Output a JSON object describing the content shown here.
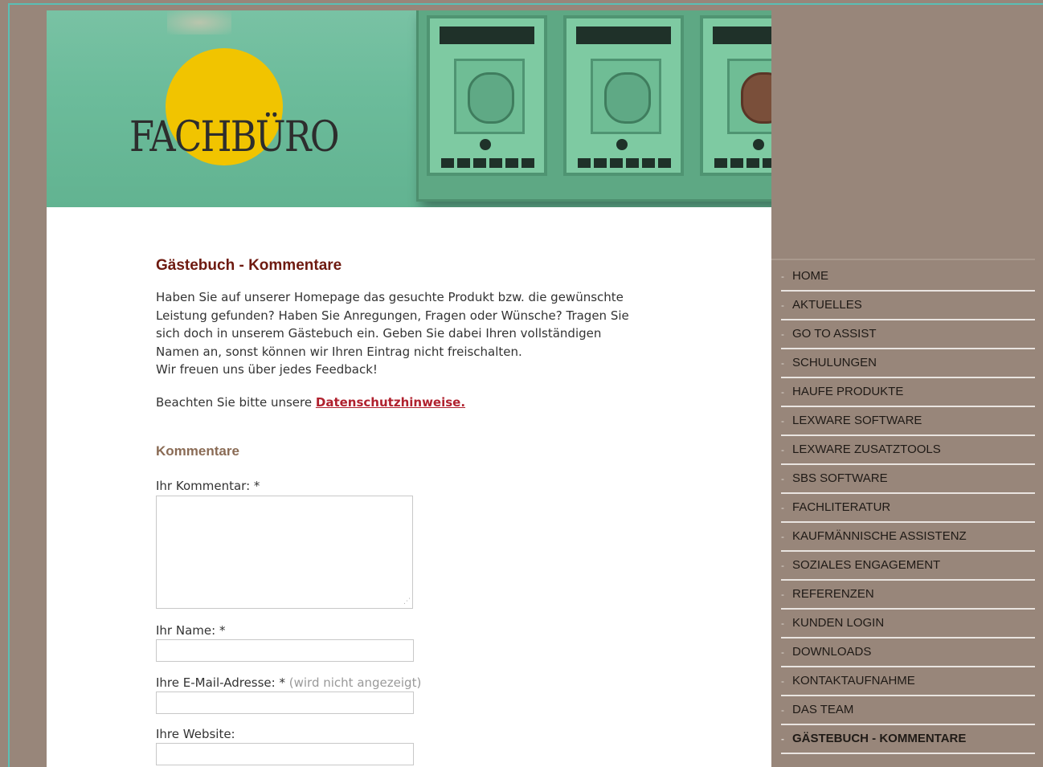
{
  "header": {
    "logo_text": "FACHBÜRO"
  },
  "main": {
    "title": "Gästebuch - Kommentare",
    "intro_lines": [
      "Haben Sie auf unserer Homepage das gesuchte Produkt bzw. die gewünschte",
      "Leistung gefunden? Haben Sie Anregungen, Fragen oder Wünsche? Tragen Sie",
      "sich doch in unserem Gästebuch ein. Geben Sie dabei Ihren vollständigen",
      "Namen an, sonst können wir Ihren Eintrag nicht freischalten.",
      "Wir freuen uns über jedes Feedback!"
    ],
    "privacy_prefix": "Beachten Sie bitte unsere",
    "privacy_link": "Datenschutzhinweise."
  },
  "comments": {
    "heading": "Kommentare",
    "comment_label": "Ihr Kommentar: *",
    "comment_value": "",
    "name_label": "Ihr Name: *",
    "name_value": "",
    "email_label": "Ihre E-Mail-Adresse: *",
    "email_hint": "(wird nicht angezeigt)",
    "email_value": "",
    "website_label": "Ihre Website:",
    "website_value": ""
  },
  "sidebar": {
    "items": [
      {
        "label": "HOME"
      },
      {
        "label": "AKTUELLES"
      },
      {
        "label": "GO TO ASSIST"
      },
      {
        "label": "SCHULUNGEN"
      },
      {
        "label": "HAUFE PRODUKTE"
      },
      {
        "label": "LEXWARE SOFTWARE"
      },
      {
        "label": "LEXWARE ZUSATZTOOLS"
      },
      {
        "label": "SBS SOFTWARE"
      },
      {
        "label": "FACHLITERATUR"
      },
      {
        "label": "KAUFMÄNNISCHE ASSISTENZ"
      },
      {
        "label": "SOZIALES ENGAGEMENT"
      },
      {
        "label": "REFERENZEN"
      },
      {
        "label": "KUNDEN LOGIN"
      },
      {
        "label": "DOWNLOADS"
      },
      {
        "label": "KONTAKTAUFNAHME"
      },
      {
        "label": "DAS TEAM"
      },
      {
        "label": "GÄSTEBUCH - KOMMENTARE"
      }
    ],
    "active_index": 16
  },
  "colors": {
    "frame": "#98867a",
    "title": "#6e1a10",
    "link": "#b0212e",
    "comments_heading": "#8a6b55",
    "logo_circle": "#f1c400"
  }
}
